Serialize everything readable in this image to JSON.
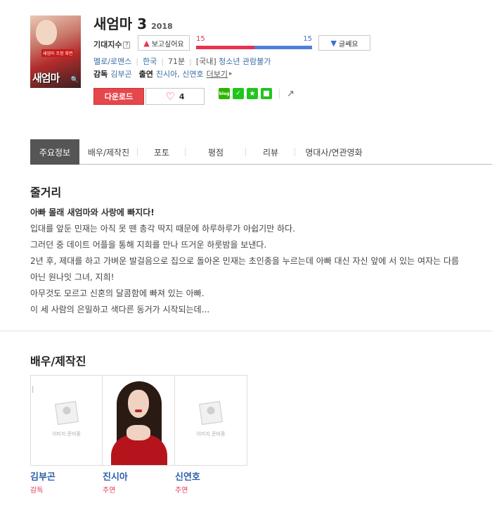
{
  "poster": {
    "tag": "새엄마 조정 화면",
    "title": "새엄마"
  },
  "movie": {
    "title": "새엄마 3",
    "year": "2018"
  },
  "expectation": {
    "label": "기대지수",
    "help": "?",
    "like_label": "보고싶어요",
    "dislike_label": "글쎄요",
    "like_count": "15",
    "dislike_count": "15",
    "like_fraction": 0.5
  },
  "meta": {
    "genre": "멜로/로맨스",
    "country": "한국",
    "runtime": "71분",
    "rating_prefix": "[국내]",
    "rating": "청소년 관람불가"
  },
  "crew": {
    "director_label": "감독",
    "director": "김부곤",
    "cast_label": "출연",
    "cast": "진시아, 신연호",
    "more": "더보기"
  },
  "actions": {
    "download": "다운로드",
    "heart_count": "4"
  },
  "share": {
    "blog": "blog"
  },
  "tabs": [
    {
      "label": "주요정보",
      "active": true
    },
    {
      "label": "배우/제작진"
    },
    {
      "label": "포토"
    },
    {
      "label": "평점"
    },
    {
      "label": "리뷰"
    },
    {
      "label": "명대사/연관영화"
    }
  ],
  "synopsis": {
    "heading": "줄거리",
    "lead": "아빠 몰래 새엄마와 사랑에 빠지다!",
    "lines": [
      "입대를 앞둔 민재는 아직 못 뗀 총각 딱지 때문에 하루하루가 아쉽기만 하다.",
      " 그러던 중 데이트 어플을 통해 지희를 만나 뜨거운 하룻밤을 보낸다.",
      " 2년 후, 제대를 하고 가벼운 발걸음으로 집으로 돌아온 민재는 초인종을 누르는데 아빠 대신 자신 앞에 서 있는 여자는 다름 아닌 원나잇 그녀, 지희!",
      " 아무것도 모르고 신혼의 달콤함에 빠져 있는 아빠.",
      " 이 세 사람의 은밀하고 색다른 동거가 시작되는데..."
    ]
  },
  "cast_section": {
    "heading": "배우/제작진",
    "placeholder": "이미지 준비중",
    "people": [
      {
        "name": "김부곤",
        "role": "감독",
        "photo": false
      },
      {
        "name": "진시아",
        "role": "주연",
        "photo": true
      },
      {
        "name": "신연호",
        "role": "주연",
        "photo": false
      }
    ]
  }
}
